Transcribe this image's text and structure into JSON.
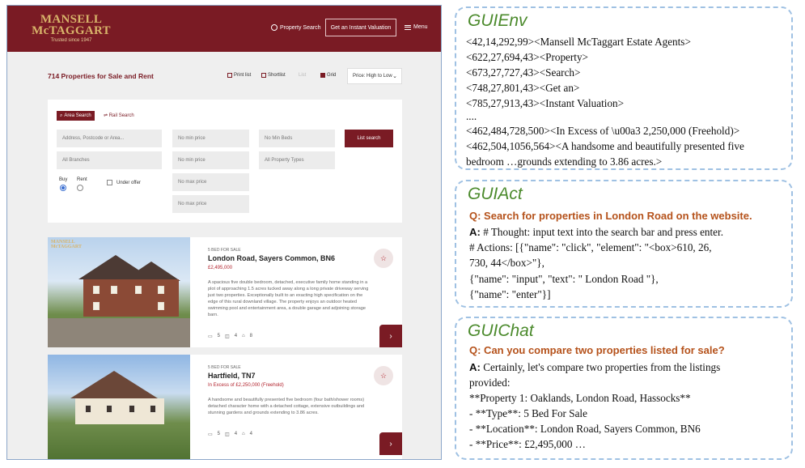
{
  "site": {
    "logo_line1": "MANSELL",
    "logo_line2": "McTAGGART",
    "logo_tagline": "Trusted since 1947",
    "nav_search": "Property Search",
    "nav_valuation": "Get an Instant Valuation",
    "nav_menu": "Menu",
    "results_title": "714 Properties for Sale and Rent",
    "tools": {
      "print": "Print list",
      "shortlist": "Shortlist",
      "list": "List",
      "grid": "Grid"
    },
    "sort": "Price: High to Low",
    "search": {
      "tab_area": "Area Search",
      "tab_rail": "Rail Search",
      "address_placeholder": "Address, Postcode or Area...",
      "min_price_1": "No min price",
      "min_beds": "No Min Beds",
      "list_button": "List search",
      "branches": "All Branches",
      "min_price_2": "No min price",
      "property_types": "All Property Types",
      "buy": "Buy",
      "rent": "Rent",
      "under_offer": "Under offer",
      "max_price_1": "No max price",
      "max_price_2": "No max price"
    },
    "listings": [
      {
        "tag": "5 BED FOR SALE",
        "title": "London Road, Sayers Common, BN6",
        "price": "£2,495,000",
        "description": [
          "A spacious five double bedroom, detached, executive family home standing in a",
          "plot of approaching 1.5 acres tucked away along a long private driveway serving",
          "just two properties. Exceptionally built to an exacting high specification on the",
          "edge of this rural downland village. The property enjoys an outdoor heated",
          "swimming pool and entertainment area, a double garage and adjoining storage",
          "barn."
        ],
        "beds": "5",
        "baths": "4",
        "receptions": "8"
      },
      {
        "tag": "5 BED FOR SALE",
        "title": "Hartfield, TN7",
        "price": "In Excess of £2,250,000 (Freehold)",
        "description": [
          "A handsome and beautifully presented five bedroom (four bath/shower rooms)",
          "detached character home with a detached cottage, extensive outbuildings and",
          "stunning gardens and grounds extending to 3.86 acres."
        ],
        "beds": "5",
        "baths": "4",
        "receptions": "4"
      }
    ]
  },
  "guienv": {
    "title": "GUIEnv",
    "lines": [
      "<42,14,292,99><Mansell McTaggart Estate Agents>",
      "<622,27,694,43><Property>",
      "<673,27,727,43><Search>",
      "<748,27,801,43><Get an>",
      " <785,27,913,43><Instant Valuation>",
      "....",
      "<462,484,728,500><In Excess of \\u00a3 2,250,000 (Freehold)>",
      "<462,504,1056,564><A handsome and beautifully presented five",
      "bedroom …grounds extending to 3.86 acres.>"
    ]
  },
  "guiact": {
    "title": "GUIAct",
    "question": "Q: Search for properties in London Road on the website.",
    "answer_label": "A:",
    "answer_first": " # Thought: input text into the search bar and press enter.",
    "lines": [
      "# Actions: [{\"name\": \"click\", \"element\": \"<box>610, 26,",
      "730, 44</box>\"},",
      " {\"name\": \"input\", \"text\": \" London Road \"},",
      " {\"name\": \"enter\"}]"
    ]
  },
  "guichat": {
    "title": "GUIChat",
    "question": "Q: Can you compare two properties listed for sale?",
    "answer_label": "A:",
    "answer_first": " Certainly, let's compare two properties from the listings",
    "lines": [
      "provided:",
      "**Property 1: Oaklands, London Road, Hassocks**",
      "- **Type**: 5 Bed For Sale",
      "- **Location**: London Road, Sayers Common, BN6",
      "- **Price**: £2,495,000 …"
    ]
  }
}
